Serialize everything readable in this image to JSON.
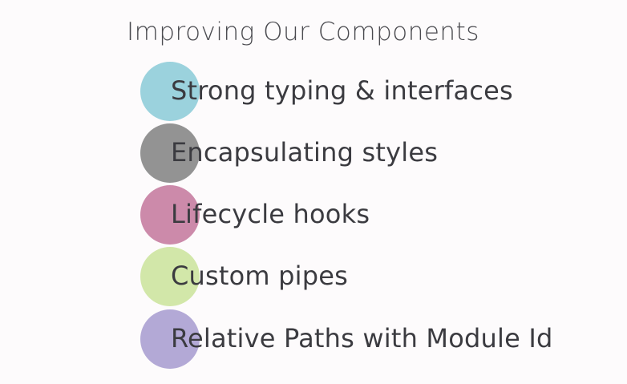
{
  "slide": {
    "title": "Improving Our Components",
    "items": [
      {
        "label": "Strong typing & interfaces",
        "color": "#9bd2dd"
      },
      {
        "label": "Encapsulating styles",
        "color": "#939393"
      },
      {
        "label": "Lifecycle hooks",
        "color": "#cc8aaa"
      },
      {
        "label": "Custom pipes",
        "color": "#d2e7a9"
      },
      {
        "label": "Relative Paths with Module Id",
        "color": "#b3a9d6"
      }
    ]
  }
}
